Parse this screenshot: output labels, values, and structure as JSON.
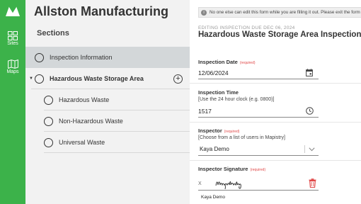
{
  "nav": {
    "items": [
      {
        "label": "Sites",
        "icon": "sites-icon"
      },
      {
        "label": "Maps",
        "icon": "map-icon"
      }
    ]
  },
  "panel": {
    "company": "Allston Manufacturing",
    "sections_title": "Sections",
    "sections": [
      {
        "label": "Inspection Information",
        "active": true
      },
      {
        "label": "Hazardous Waste Storage Area",
        "expanded": true,
        "bold": true
      },
      {
        "label": "Hazardous Waste"
      },
      {
        "label": "Non-Hazardous Waste"
      },
      {
        "label": "Universal Waste"
      }
    ]
  },
  "form": {
    "banner": "No one else can edit this form while you are filling it out. Please exit the form",
    "editing": "EDITING INSPECTION DUE DEC 06, 2024",
    "title": "Hazardous Waste Storage Area Inspection",
    "required_text": "(required)",
    "date": {
      "label": "Inspection Date",
      "value": "12/06/2024"
    },
    "time": {
      "label": "Inspection Time",
      "hint": "[Use the 24 hour clock (e.g. 0800)]",
      "value": "1517"
    },
    "inspector": {
      "label": "Inspector",
      "hint": "[Choose from a list of users in Mapistry]",
      "value": "Kaya Demo"
    },
    "signature": {
      "label": "Inspector Signature",
      "x_mark": "X",
      "name": "Kaya Demo"
    }
  },
  "colors": {
    "brand_green": "#3cb24a",
    "required_red": "#e04848",
    "active_section": "#d3d7d9"
  }
}
